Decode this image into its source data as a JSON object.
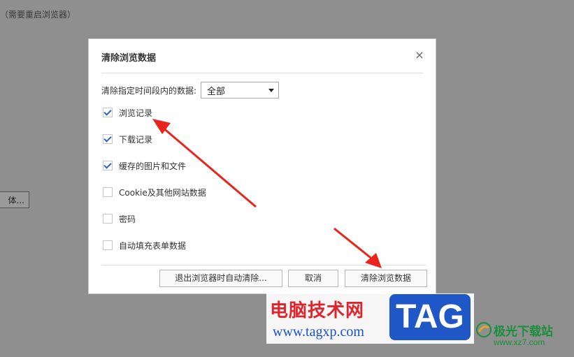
{
  "background": {
    "note": "（需要重启浏览器）",
    "button_label": "体..."
  },
  "dialog": {
    "title": "清除浏览数据",
    "close_symbol": "×",
    "range": {
      "label": "清除指定时间段内的数据:",
      "selected": "全部"
    },
    "options": [
      {
        "label": "浏览记录",
        "checked": true
      },
      {
        "label": "下载记录",
        "checked": true
      },
      {
        "label": "缓存的图片和文件",
        "checked": true
      },
      {
        "label": "Cookie及其他网站数据",
        "checked": false
      },
      {
        "label": "密码",
        "checked": false
      },
      {
        "label": "自动填充表单数据",
        "checked": false
      }
    ],
    "buttons": {
      "auto_clear": "退出浏览器时自动清除...",
      "cancel": "取消",
      "clear": "清除浏览数据"
    }
  },
  "annotation": {
    "arrow_color": "#e8241c"
  },
  "watermark": {
    "site_cn": "电脑技术网",
    "site_url": "www.tagxp.com",
    "tag": "TAG",
    "site2_cn": "极光下载站",
    "site2_url": "www.xz7.com"
  }
}
